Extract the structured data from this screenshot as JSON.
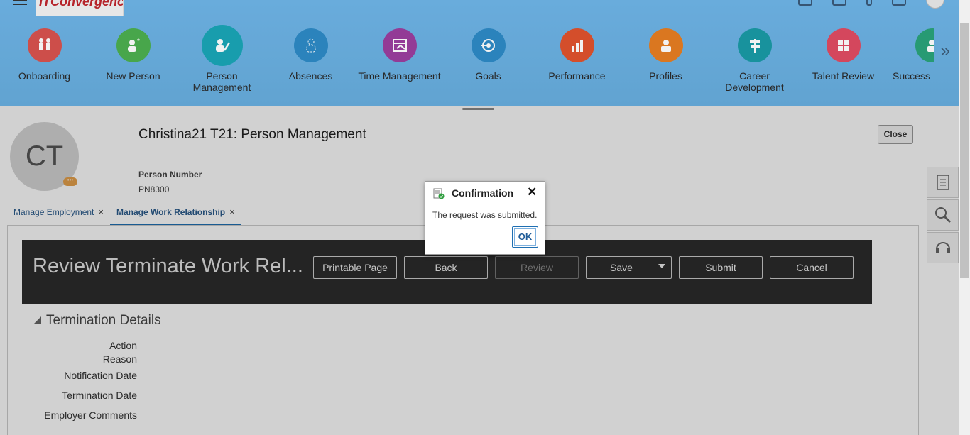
{
  "header": {
    "logo_text": "ITConvergence",
    "icons": [
      "home-icon",
      "favorites-icon",
      "pin-icon",
      "notifications-icon",
      "user-menu-icon"
    ]
  },
  "springboard": {
    "apps": [
      {
        "label": "Onboarding",
        "color": "#d9534f",
        "icon": "onboarding-icon"
      },
      {
        "label": "New Person",
        "color": "#4caf50",
        "icon": "new-person-icon"
      },
      {
        "label": "Person Management",
        "color": "#1aa6b7",
        "icon": "person-management-icon"
      },
      {
        "label": "Absences",
        "color": "#2e8bc7",
        "icon": "absences-icon"
      },
      {
        "label": "Time Management",
        "color": "#9b3f9f",
        "icon": "time-management-icon"
      },
      {
        "label": "Goals",
        "color": "#2e8bc7",
        "icon": "goals-icon"
      },
      {
        "label": "Performance",
        "color": "#e0532e",
        "icon": "performance-icon"
      },
      {
        "label": "Profiles",
        "color": "#e67e22",
        "icon": "profiles-icon"
      },
      {
        "label": "Career Development",
        "color": "#1a9aa6",
        "icon": "career-development-icon"
      },
      {
        "label": "Talent Review",
        "color": "#e04b63",
        "icon": "talent-review-icon"
      },
      {
        "label": "Success",
        "color": "#2aa37a",
        "icon": "succession-icon"
      }
    ],
    "more_label": "»"
  },
  "person": {
    "initials": "CT",
    "title": "Christina21 T21: Person Management",
    "number_label": "Person Number",
    "number_value": "PN8300",
    "close_label": "Close"
  },
  "tabs": [
    {
      "label": "Manage Employment",
      "active": false
    },
    {
      "label": "Manage Work Relationship",
      "active": true
    }
  ],
  "train": {
    "title": "Review Terminate Work Rel...",
    "buttons": {
      "printable": "Printable Page",
      "back": "Back",
      "review": "Review",
      "save": "Save",
      "submit": "Submit",
      "cancel": "Cancel"
    }
  },
  "section": {
    "title": "Termination Details",
    "fields": [
      "Action",
      "Reason",
      "Notification Date",
      "Termination Date",
      "Employer Comments"
    ]
  },
  "dialog": {
    "title": "Confirmation",
    "message": "The request was submitted.",
    "ok_label": "OK"
  }
}
